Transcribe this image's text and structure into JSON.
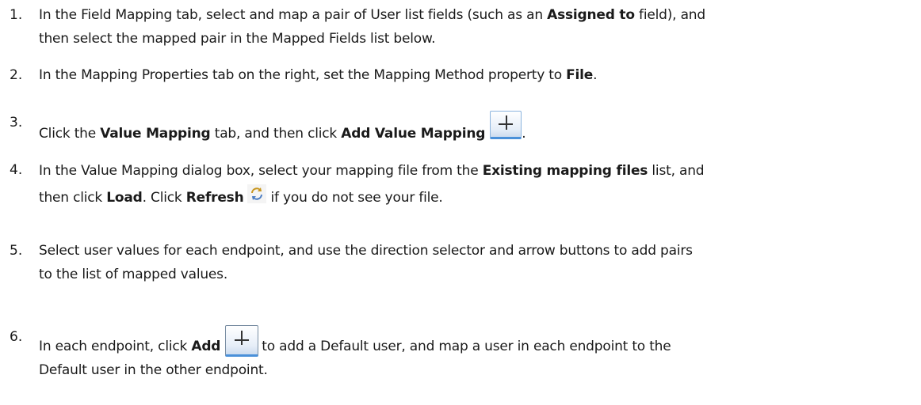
{
  "steps": [
    {
      "num": "1.",
      "line1_a": "In the Field Mapping tab, select and map a pair of User list fields (such as an ",
      "line1_b": "Assigned to",
      "line1_c": " field), and",
      "line2": "then select the mapped pair in the Mapped Fields list below."
    },
    {
      "num": "2.",
      "a": "In the Mapping Properties tab on the right, set the Mapping Method property to ",
      "b": "File",
      "c": "."
    },
    {
      "num": "3.",
      "a": "Click the ",
      "b": "Value Mapping",
      "c": " tab, and then click ",
      "d": "Add Value Mapping",
      "e": "."
    },
    {
      "num": "4.",
      "line1_a": "In the Value Mapping dialog box, select your mapping file from the ",
      "line1_b": "Existing mapping files",
      "line1_c": " list, and",
      "line2_a": "then click ",
      "line2_b": "Load",
      "line2_c": ". Click ",
      "line2_d": "Refresh",
      "line2_e": "if you do not see your file."
    },
    {
      "num": "5.",
      "line1": "Select user values for each endpoint, and use the direction selector and arrow buttons to add pairs",
      "line2": "to the list of mapped values."
    },
    {
      "num": "6.",
      "line1_a": "In each endpoint, click ",
      "line1_b": "Add",
      "line1_c": "to add a Default user, and map a user in each endpoint to the",
      "line2": "Default user in the other endpoint."
    }
  ],
  "icons": {
    "add": "plus-icon",
    "refresh": "refresh-icon"
  }
}
